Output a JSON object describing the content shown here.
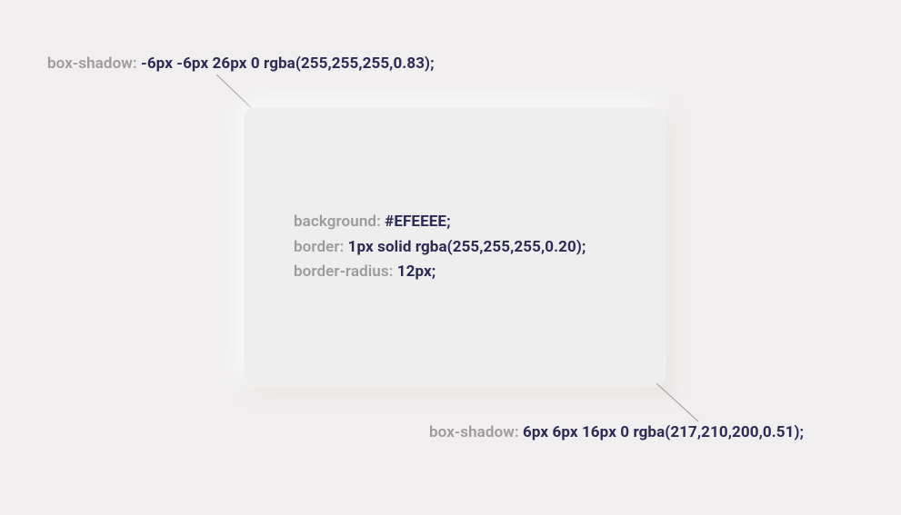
{
  "top_shadow": {
    "property": "box-shadow:",
    "value": "-6px -6px 26px 0 rgba(255,255,255,0.83);"
  },
  "bottom_shadow": {
    "property": "box-shadow:",
    "value": "6px 6px 16px 0 rgba(217,210,200,0.51);"
  },
  "card": {
    "lines": [
      {
        "property": "background:",
        "value": "#EFEEEE;"
      },
      {
        "property": "border:",
        "value": "1px solid rgba(255,255,255,0.20);"
      },
      {
        "property": "border-radius:",
        "value": "12px;"
      }
    ]
  }
}
